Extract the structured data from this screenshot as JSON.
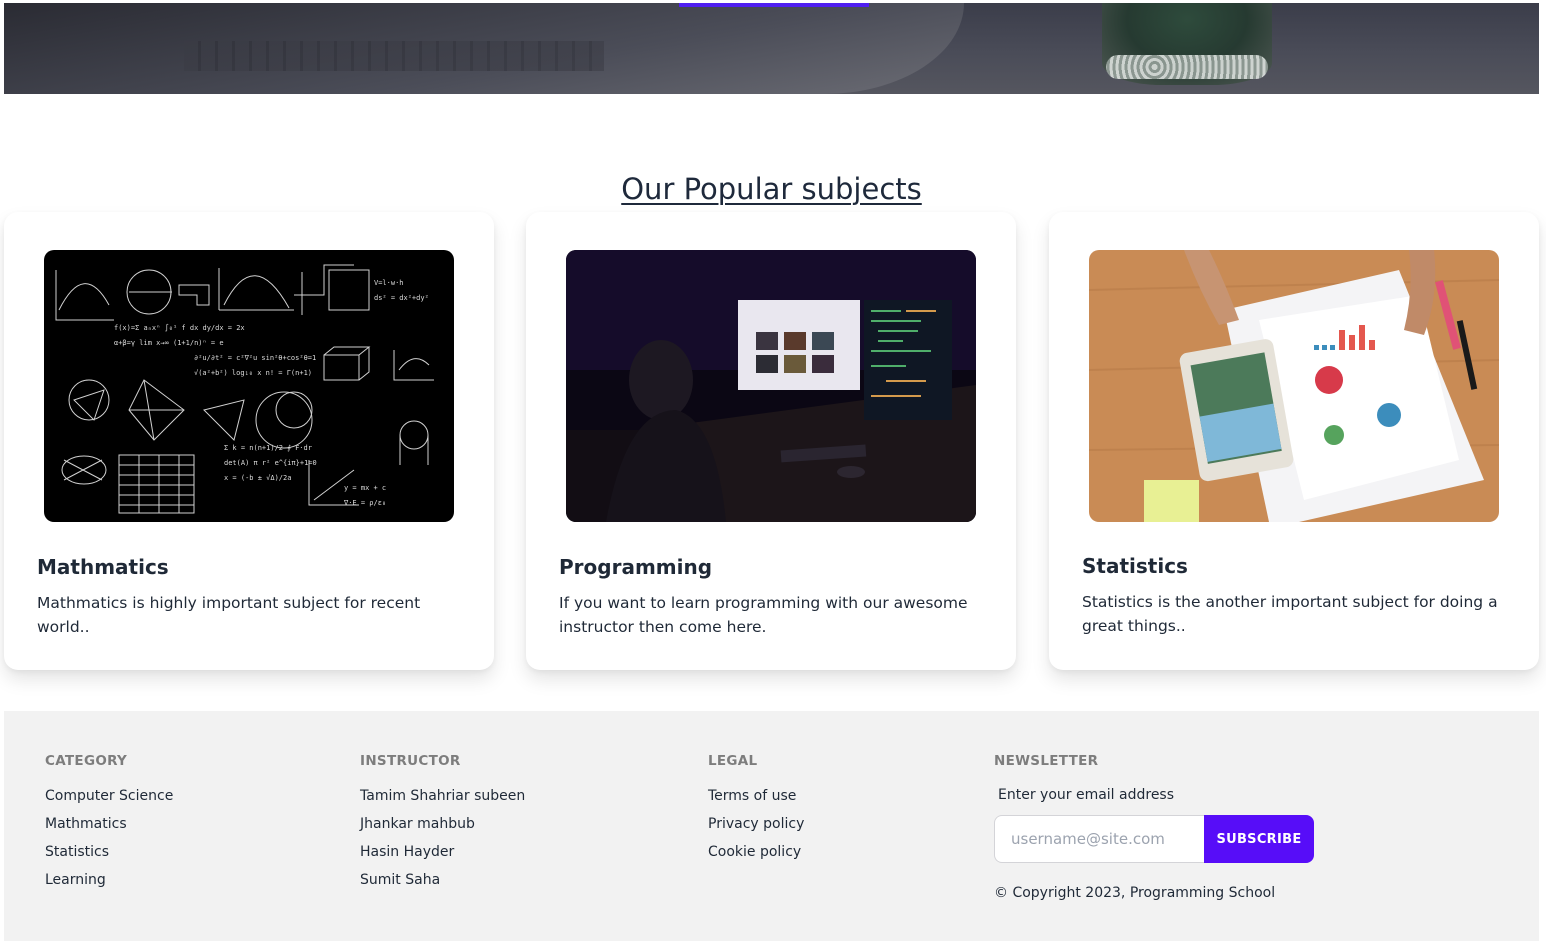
{
  "section": {
    "title": "Our Popular subjects"
  },
  "cards": [
    {
      "title": "Mathmatics",
      "description": "Mathmatics is highly important subject for recent world..",
      "image_icon": "math-chalkboard-image"
    },
    {
      "title": "Programming",
      "description": "If you want to learn programming with our awesome instructor then come here.",
      "image_icon": "programmer-desk-image"
    },
    {
      "title": "Statistics",
      "description": "Statistics is the another important subject for doing a great things..",
      "image_icon": "charts-tablet-image"
    }
  ],
  "footer": {
    "category": {
      "heading": "CATEGORY",
      "links": [
        "Computer Science",
        "Mathmatics",
        "Statistics",
        "Learning"
      ]
    },
    "instructor": {
      "heading": "INSTRUCTOR",
      "links": [
        "Tamim Shahriar subeen",
        "Jhankar mahbub",
        "Hasin Hayder",
        "Sumit Saha"
      ]
    },
    "legal": {
      "heading": "LEGAL",
      "links": [
        "Terms of use",
        "Privacy policy",
        "Cookie policy"
      ]
    },
    "newsletter": {
      "heading": "NEWSLETTER",
      "label": "Enter your email address",
      "placeholder": "username@site.com",
      "button_label": "SUBSCRIBE",
      "copyright": "© Copyright 2023, Programming School"
    }
  },
  "colors": {
    "accent": "#570df8",
    "footer_bg": "#f2f2f2"
  }
}
